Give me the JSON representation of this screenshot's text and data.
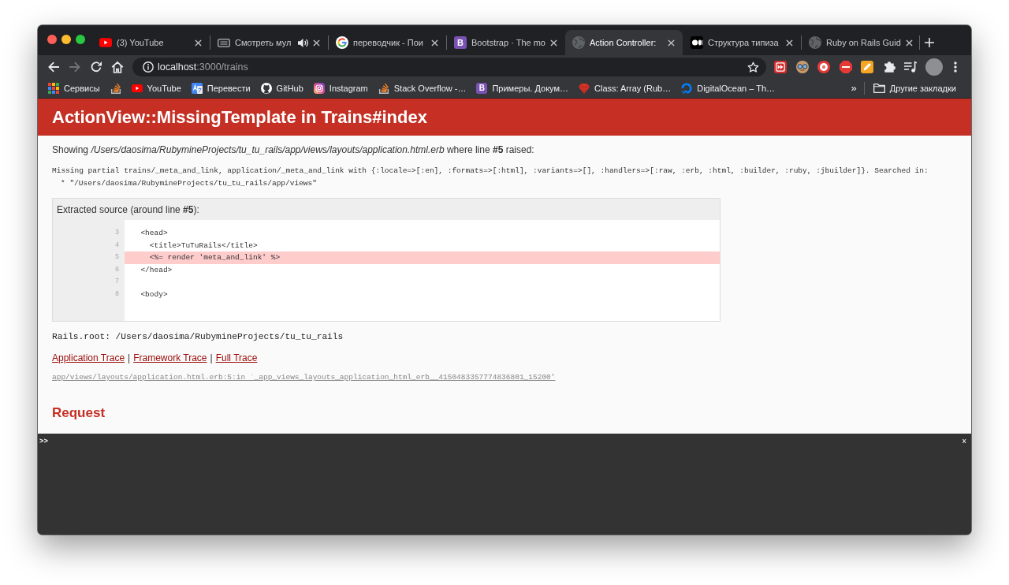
{
  "window": {
    "tabs": [
      {
        "title": "(3) YouTube",
        "selected": false,
        "audio": false
      },
      {
        "title": "Смотреть мул",
        "selected": false,
        "audio": true
      },
      {
        "title": "переводчик - Пои",
        "selected": false,
        "audio": false
      },
      {
        "title": "Bootstrap · The mo",
        "selected": false,
        "audio": false,
        "favicon_letter": "B"
      },
      {
        "title": "Action Controller:",
        "selected": true,
        "audio": false
      },
      {
        "title": "Структура типиза",
        "selected": false,
        "audio": false
      },
      {
        "title": "Ruby on Rails Guid",
        "selected": false,
        "audio": false
      }
    ]
  },
  "toolbar": {
    "back_disabled": false,
    "forward_disabled": true,
    "address": {
      "host": "localhost",
      "path": ":3000/trains"
    },
    "bookmarked": false
  },
  "bookmarks": {
    "items": [
      {
        "kind": "link",
        "label": "Сервисы"
      },
      {
        "kind": "icon"
      },
      {
        "kind": "link",
        "label": "YouTube"
      },
      {
        "kind": "link",
        "label": "Перевести"
      },
      {
        "kind": "link",
        "label": "GitHub"
      },
      {
        "kind": "link",
        "label": "Instagram"
      },
      {
        "kind": "link",
        "label": "Stack Overflow -…"
      },
      {
        "kind": "link",
        "label": "Примеры. Докум…",
        "favicon_letter": "B"
      },
      {
        "kind": "link",
        "label": "Class: Array (Rub…"
      },
      {
        "kind": "link",
        "label": "DigitalOcean – Th…"
      }
    ],
    "overflow": "»",
    "other_bookmarks": "Другие закладки"
  },
  "error_page": {
    "title": "ActionView::MissingTemplate in Trains#index",
    "summary": "Showing */Users/daosima/RubymineProjects/tu_tu_rails/app/views/layouts/application.html.erb* where line **#5** raised:",
    "message": "Missing partial trains/_meta_and_link, application/_meta_and_link with {:locale=>[:en], :formats=>[:html], :variants=>[], :handlers=>[:raw, :erb, :html, :builder, :ruby, :jbuilder]}. Searched in:",
    "search_paths": [
      "* \"/Users/daosima/RubymineProjects/tu_tu_rails/app/views\""
    ],
    "source": {
      "title": "Extracted source (around line **#5**):",
      "lines": [
        {
          "number": "3",
          "code": "  <head>",
          "highlighted": false
        },
        {
          "number": "4",
          "code": "    <title>TuTuRails</title>",
          "highlighted": false
        },
        {
          "number": "5",
          "code": "    <%= render 'meta_and_link' %>",
          "highlighted": true
        },
        {
          "number": "6",
          "code": "  </head>",
          "highlighted": false
        },
        {
          "number": "7",
          "highlighted": false
        },
        {
          "number": "8",
          "code": "  <body>",
          "highlighted": false
        }
      ]
    },
    "rails_root": "Rails.root: /Users/daosima/RubymineProjects/tu_tu_rails",
    "trace_links": [
      {
        "kind": "link",
        "label": "Application Trace"
      },
      {
        "kind": "separator",
        "label": "|"
      },
      {
        "kind": "link",
        "label": "Framework Trace"
      },
      {
        "kind": "separator",
        "label": "|"
      },
      {
        "kind": "link",
        "label": "Full Trace"
      }
    ],
    "trace": [
      "app/views/layouts/application.html.erb:5:in `_app_views_layouts_application_html_erb__4150483357774836801_15200'"
    ],
    "request_heading": "Request"
  },
  "console": {
    "prompt": ">>",
    "close": "x"
  }
}
